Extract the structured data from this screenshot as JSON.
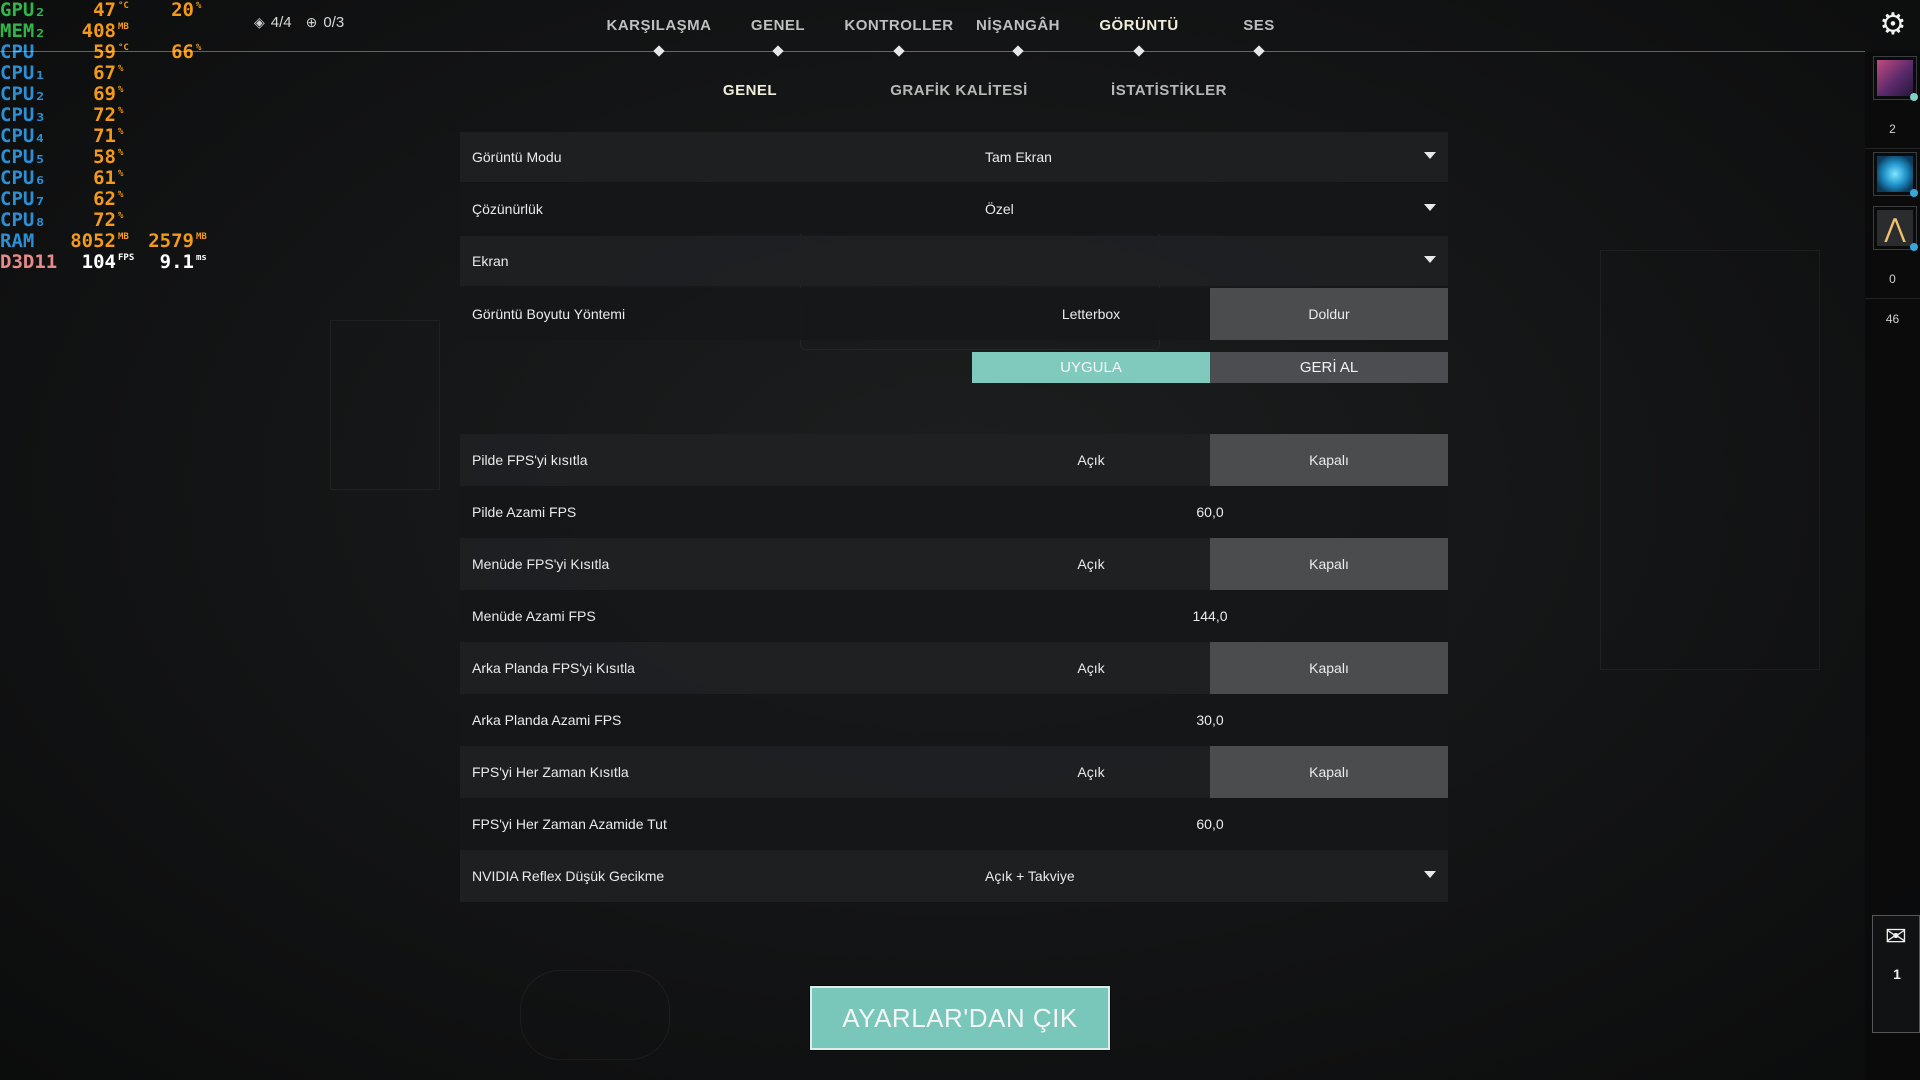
{
  "osd": {
    "rows": [
      {
        "label": "GPU₂",
        "label_color": "#2fb54a",
        "v1": "47",
        "u1": "°C",
        "v2": "20",
        "u2": "%"
      },
      {
        "label": "MEM₂",
        "label_color": "#2fb54a",
        "v1": "408",
        "u1": "MB",
        "v2": "",
        "u2": ""
      },
      {
        "label": "CPU",
        "label_color": "#2b8fd6",
        "v1": "59",
        "u1": "°C",
        "v2": "66",
        "u2": "%"
      },
      {
        "label": "CPU₁",
        "label_color": "#2b8fd6",
        "v1": "67",
        "u1": "%",
        "v2": "",
        "u2": ""
      },
      {
        "label": "CPU₂",
        "label_color": "#2b8fd6",
        "v1": "69",
        "u1": "%",
        "v2": "",
        "u2": ""
      },
      {
        "label": "CPU₃",
        "label_color": "#2b8fd6",
        "v1": "72",
        "u1": "%",
        "v2": "",
        "u2": ""
      },
      {
        "label": "CPU₄",
        "label_color": "#2b8fd6",
        "v1": "71",
        "u1": "%",
        "v2": "",
        "u2": ""
      },
      {
        "label": "CPU₅",
        "label_color": "#2b8fd6",
        "v1": "58",
        "u1": "%",
        "v2": "",
        "u2": ""
      },
      {
        "label": "CPU₆",
        "label_color": "#2b8fd6",
        "v1": "61",
        "u1": "%",
        "v2": "",
        "u2": ""
      },
      {
        "label": "CPU₇",
        "label_color": "#2b8fd6",
        "v1": "62",
        "u1": "%",
        "v2": "",
        "u2": ""
      },
      {
        "label": "CPU₈",
        "label_color": "#2b8fd6",
        "v1": "72",
        "u1": "%",
        "v2": "",
        "u2": ""
      },
      {
        "label": "RAM",
        "label_color": "#2b8fd6",
        "v1": "8052",
        "u1": "MB",
        "v2": "2579",
        "u2": "MB"
      },
      {
        "label": "D3D11",
        "label_color": "#e88a8a",
        "v1": "104",
        "u1": "FPS",
        "v2": "9.1",
        "u2": "ms",
        "white": true
      }
    ]
  },
  "counters": {
    "left": {
      "icon": "diamond-icon",
      "glyph": "◈",
      "text": "4/4"
    },
    "right": {
      "icon": "plus-circle-icon",
      "glyph": "⊕",
      "text": "0/3"
    }
  },
  "main_nav": [
    {
      "label": "KARŞILAŞMA",
      "active": false
    },
    {
      "label": "GENEL",
      "active": false
    },
    {
      "label": "KONTROLLER",
      "active": false
    },
    {
      "label": "NİŞANGÂH",
      "active": false
    },
    {
      "label": "GÖRÜNTÜ",
      "active": true
    },
    {
      "label": "SES",
      "active": false
    }
  ],
  "sub_nav": [
    {
      "label": "GENEL",
      "active": true
    },
    {
      "label": "GRAFİK KALİTESİ",
      "active": false
    },
    {
      "label": "İSTATİSTİKLER",
      "active": false
    }
  ],
  "settings": {
    "display_mode": {
      "label": "Görüntü Modu",
      "value": "Tam Ekran"
    },
    "resolution": {
      "label": "Çözünürlük",
      "value": "Özel"
    },
    "monitor": {
      "label": "Ekran",
      "value": ""
    },
    "aspect_method": {
      "label": "Görüntü Boyutu Yöntemi",
      "opt1": "Letterbox",
      "opt2": "Doldur"
    },
    "apply_label": "UYGULA",
    "revert_label": "GERİ AL",
    "limit_battery": {
      "label": "Pilde FPS'yi kısıtla",
      "on": "Açık",
      "off": "Kapalı"
    },
    "max_battery": {
      "label": "Pilde Azami FPS",
      "value": "60,0"
    },
    "limit_menu": {
      "label": "Menüde FPS'yi Kısıtla",
      "on": "Açık",
      "off": "Kapalı"
    },
    "max_menu": {
      "label": "Menüde Azami FPS",
      "value": "144,0"
    },
    "limit_background": {
      "label": "Arka Planda FPS'yi Kısıtla",
      "on": "Açık",
      "off": "Kapalı"
    },
    "max_background": {
      "label": "Arka Planda Azami FPS",
      "value": "30,0"
    },
    "limit_always": {
      "label": "FPS'yi Her Zaman Kısıtla",
      "on": "Açık",
      "off": "Kapalı"
    },
    "max_always": {
      "label": "FPS'yi Her Zaman Azamide Tut",
      "value": "60,0"
    },
    "reflex": {
      "label": "NVIDIA Reflex Düşük Gecikme",
      "value": "Açık + Takviye"
    }
  },
  "exit_label": "AYARLAR'DAN ÇIK",
  "right_bar": {
    "count_a": "2",
    "count_b": "0",
    "count_c": "46",
    "mail_count": "1"
  },
  "colors": {
    "accent": "#7fc9bd",
    "selected_toggle": "#4a4c4e"
  }
}
